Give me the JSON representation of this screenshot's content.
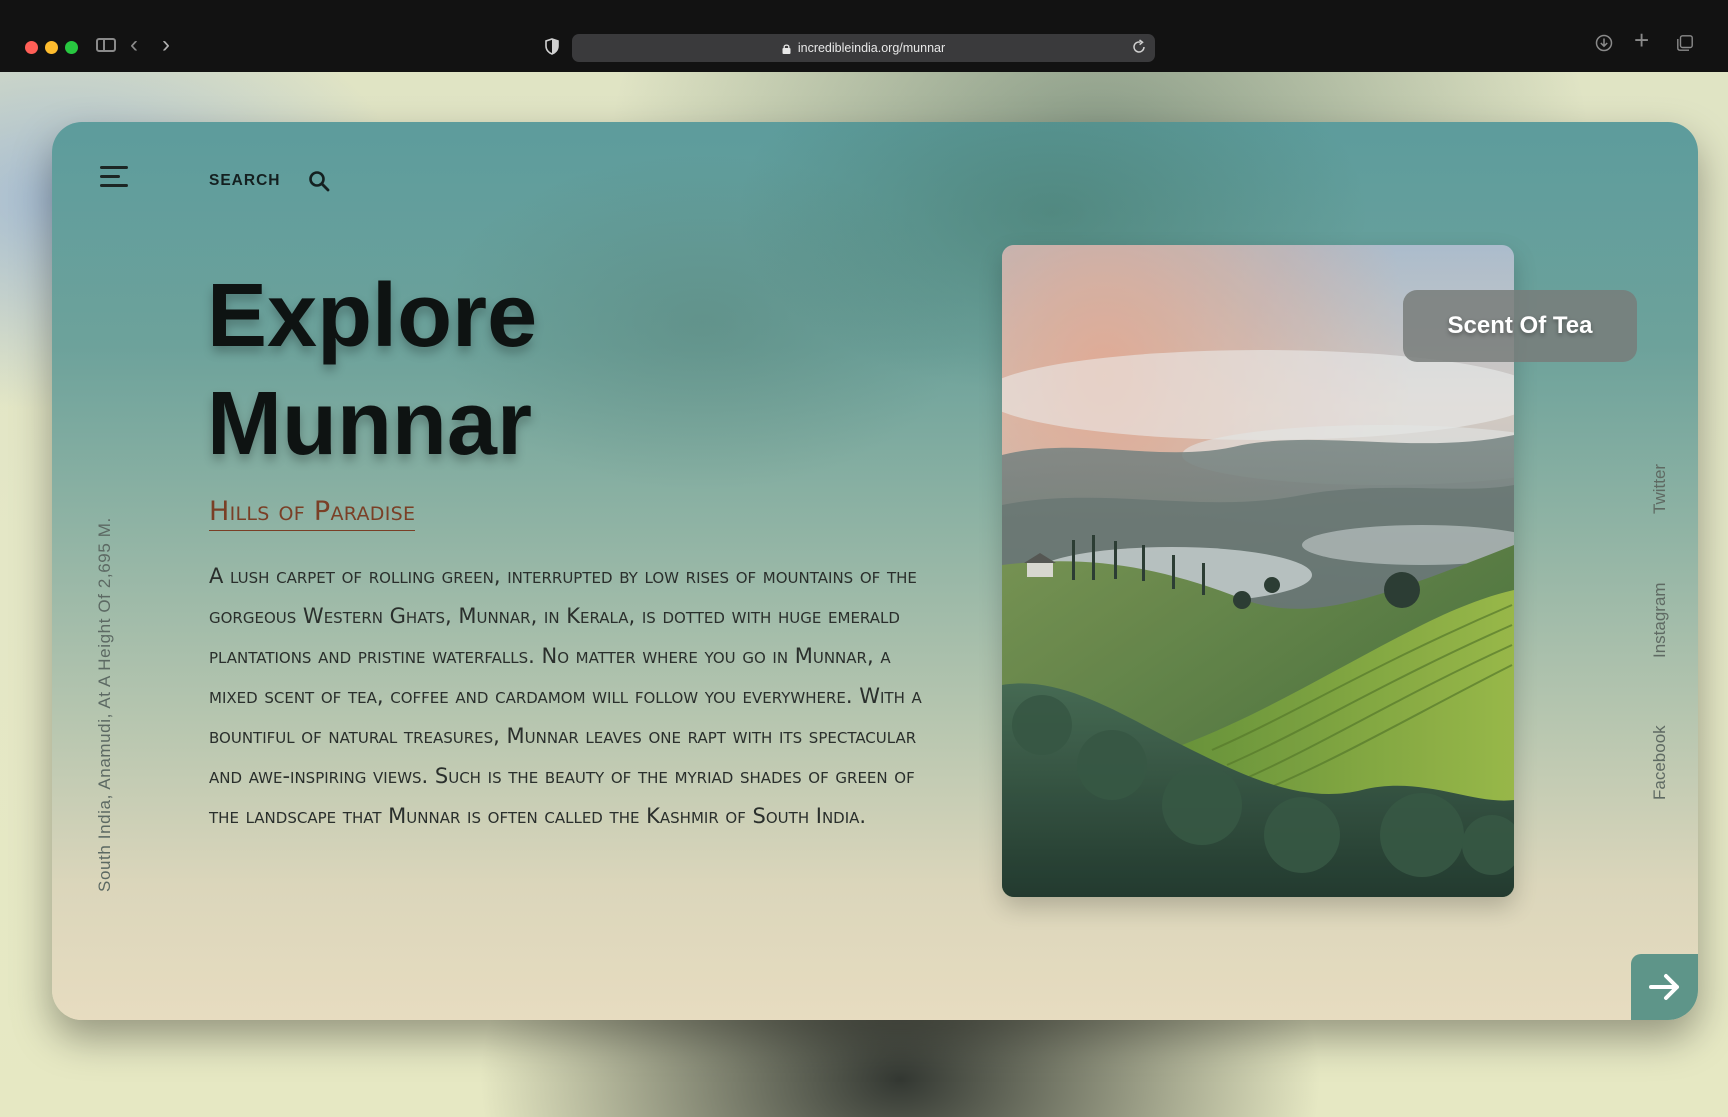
{
  "browser": {
    "url": "incredibleindia.org/munnar"
  },
  "header": {
    "search_label": "SEARCH"
  },
  "hero": {
    "title_line1": "Explore",
    "title_line2": "Munnar",
    "subtitle": "Hills of Paradise",
    "description": "A lush carpet of rolling green, interrupted by low rises of mountains of the gorgeous Western Ghats, Munnar, in Kerala, is dotted with huge emerald plantations and pristine waterfalls. No matter where you go in Munnar, a mixed scent of tea, coffee and cardamom will follow you everywhere. With a bountiful of natural treasures, Munnar leaves one rapt with its spectacular and awe-inspiring views. Such is the beauty of the myriad shades of green of the landscape that Munnar is often called the Kashmir of South India.",
    "side_caption": "South India, Anamudi, At A Height Of 2,695 M."
  },
  "photo": {
    "badge": "Scent Of Tea"
  },
  "social": {
    "twitter": "Twitter",
    "instagram": "Instagram",
    "facebook": "Facebook"
  },
  "colors": {
    "accent": "#5e9589",
    "subtitle": "#7a3f26",
    "title": "#0e1312"
  },
  "icons": {
    "menu": "hamburger-menu-icon",
    "search": "magnifier-icon",
    "next": "arrow-right-icon"
  }
}
